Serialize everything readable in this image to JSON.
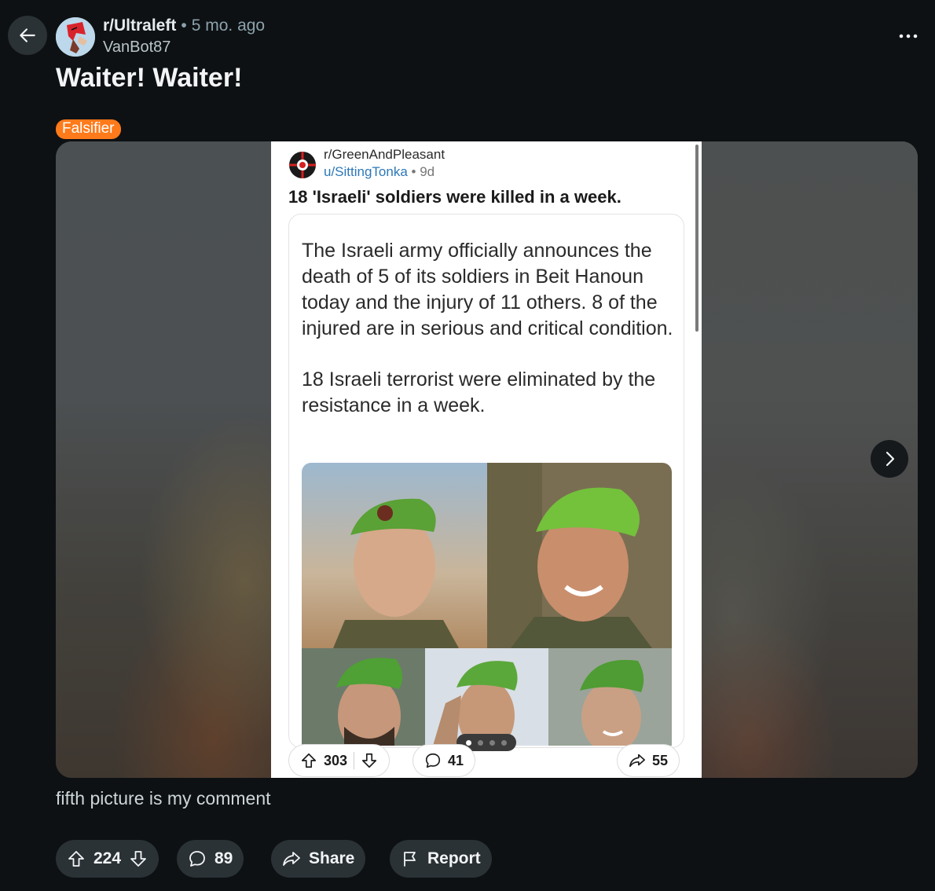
{
  "post": {
    "subreddit": "r/Ultraleft",
    "separator": "•",
    "time": "5 mo. ago",
    "author": "VanBot87",
    "title": "Waiter! Waiter!",
    "flair": "Falsifier",
    "flair_color": "#ff7a1a",
    "body": "fifth picture is my comment"
  },
  "gallery": {
    "current_image": 1,
    "embedded_post": {
      "subreddit": "r/GreenAndPleasant",
      "author": "u/SittingTonka",
      "separator": "•",
      "time": "9d",
      "title": "18 'Israeli' soldiers were killed in a week.",
      "paragraphs": [
        "The Israeli army officially announces the death of 5 of its soldiers in Beit Hanoun today and the injury of 11 others. 8 of the injured are in serious and critical condition.",
        "18 Israeli terrorist were eliminated by the resistance in a week."
      ],
      "upvotes": "303",
      "comments": "41",
      "shares": "55",
      "page_dots": 4,
      "active_dot": 1
    }
  },
  "actions": {
    "votes": "224",
    "comments": "89",
    "share_label": "Share",
    "report_label": "Report"
  },
  "icons": {
    "back": "arrow-left-icon",
    "more": "more-horizontal-icon",
    "next": "chevron-right-icon",
    "upvote": "arrow-up-icon",
    "downvote": "arrow-down-icon",
    "comment": "comment-bubble-icon",
    "share": "share-arrow-icon",
    "report": "flag-icon"
  }
}
